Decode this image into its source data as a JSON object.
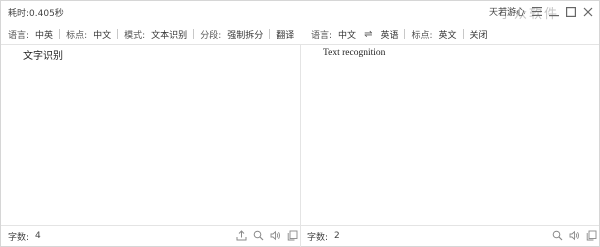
{
  "header": {
    "elapsed_label": "耗时:",
    "elapsed_value": "0.405秒",
    "user_label": "天若游心",
    "watermark": "小众软件"
  },
  "left_options": {
    "language_label": "语言:",
    "language_value": "中英",
    "punctuation_label": "标点:",
    "punctuation_value": "中文",
    "mode_label": "模式:",
    "mode_value": "文本识别",
    "segment_label": "分段:",
    "segment_value": "强制拆分",
    "translate_label": "翻译"
  },
  "right_options": {
    "language_label": "语言:",
    "source_lang": "中文",
    "swap_symbol": "⇌",
    "target_lang": "英语",
    "punctuation_label": "标点:",
    "punctuation_value": "英文",
    "close_label": "关闭"
  },
  "source": {
    "text": "文字识别"
  },
  "target": {
    "text": "Text recognition"
  },
  "left_footer": {
    "count_label": "字数:",
    "count_value": "4"
  },
  "right_footer": {
    "count_label": "字数:",
    "count_value": "2"
  },
  "icons": {
    "title_menu": "menu-icon",
    "title_minimize": "minimize-icon",
    "title_maximize": "maximize-icon",
    "title_close": "close-icon",
    "left_footer": [
      "upload-icon",
      "search-icon",
      "speaker-icon",
      "copy-icon"
    ],
    "right_footer": [
      "search-icon",
      "speaker-icon",
      "copy-icon"
    ]
  },
  "colors": {
    "background": "#ffffff",
    "divider": "#e4e4e4",
    "text": "#333333",
    "icon": "#8a8a8a"
  }
}
